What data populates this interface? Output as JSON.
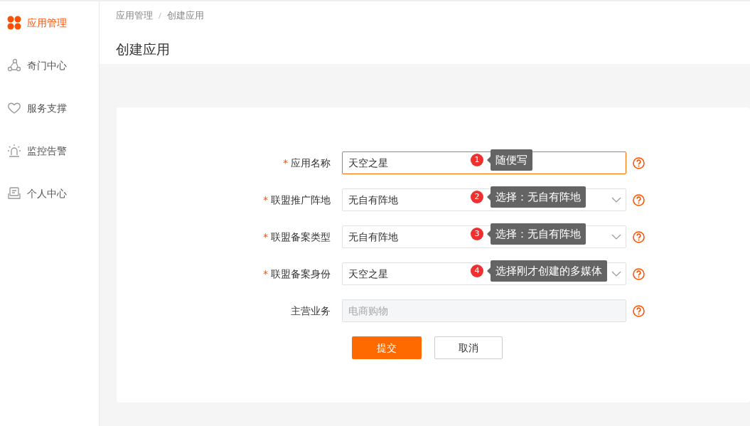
{
  "sidebar": {
    "items": [
      {
        "label": "应用管理",
        "selected": true
      },
      {
        "label": "奇门中心",
        "selected": false
      },
      {
        "label": "服务支撑",
        "selected": false
      },
      {
        "label": "监控告警",
        "selected": false
      },
      {
        "label": "个人中心",
        "selected": false
      }
    ]
  },
  "breadcrumb": [
    "应用管理",
    "创建应用"
  ],
  "page_title": "创建应用",
  "form": {
    "fields": [
      {
        "label": "应用名称",
        "required_mark": "*",
        "kind": "input",
        "value": "天空之星",
        "focused": true,
        "annotation": {
          "number": "1",
          "text": "随便写"
        }
      },
      {
        "label": "联盟推广阵地",
        "required_mark": "*",
        "kind": "select",
        "value": "无自有阵地",
        "focused": false,
        "annotation": {
          "number": "2",
          "text": "选择：无自有阵地"
        }
      },
      {
        "label": "联盟备案类型",
        "required_mark": "*",
        "kind": "select",
        "value": "无自有阵地",
        "focused": false,
        "annotation": {
          "number": "3",
          "text": "选择：无自有阵地"
        }
      },
      {
        "label": "联盟备案身份",
        "required_mark": "*",
        "kind": "select",
        "value": "天空之星",
        "focused": false,
        "annotation": {
          "number": "4",
          "text": "选择刚才创建的多媒体"
        }
      },
      {
        "label": "主营业务",
        "kind": "disabled",
        "placeholder": "电商购物",
        "focused": false
      }
    ],
    "buttons": [
      {
        "label": "提交",
        "kind": "primary"
      },
      {
        "label": "取消",
        "kind": "secondary"
      }
    ]
  }
}
